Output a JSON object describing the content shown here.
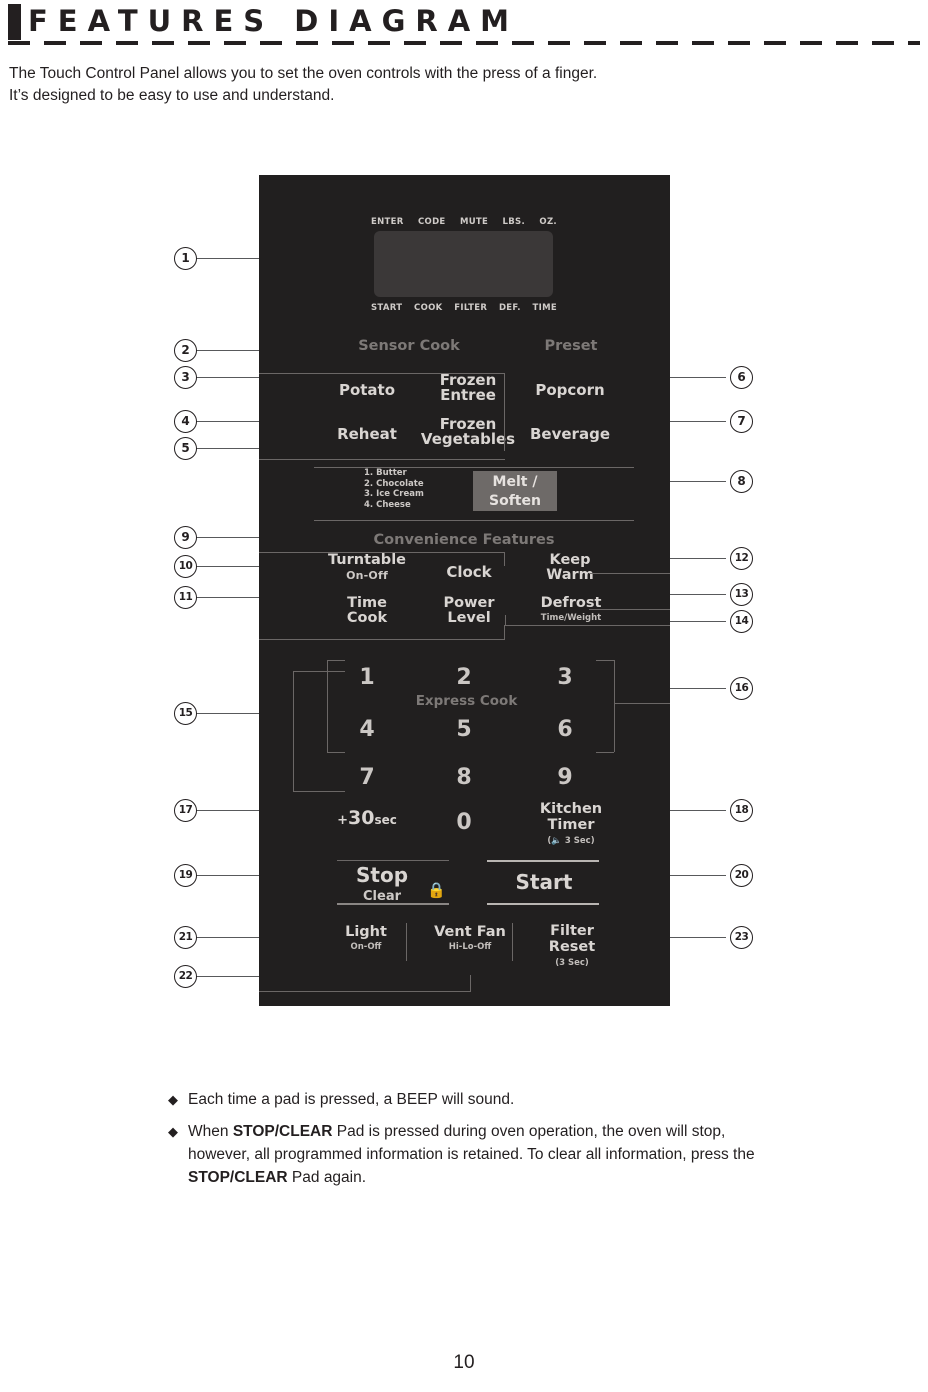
{
  "header": {
    "title": "FEATURES DIAGRAM"
  },
  "intro": {
    "line1": "The Touch Control Panel allows you to set the oven controls with the press of a finger.",
    "line2": "It’s designed to be easy to use and understand."
  },
  "panel": {
    "display": {
      "top_indicators": [
        "ENTER",
        "CODE",
        "MUTE",
        "LBS.",
        "OZ."
      ],
      "bottom_indicators": [
        "START",
        "COOK",
        "FILTER",
        "DEF.",
        "TIME"
      ]
    },
    "sections": {
      "sensor_cook": "Sensor Cook",
      "preset": "Preset",
      "convenience": "Convenience Features",
      "express_cook": "Express Cook"
    },
    "pads": {
      "potato": "Potato",
      "reheat": "Reheat",
      "frozen_entree": {
        "line1": "Frozen",
        "line2": "Entree"
      },
      "frozen_vegetables": {
        "line1": "Frozen",
        "line2": "Vegetables"
      },
      "popcorn": "Popcorn",
      "beverage": "Beverage",
      "melt_soften": {
        "line1": "Melt /",
        "line2": "Soften"
      },
      "melt_list": [
        "1. Butter",
        "2. Chocolate",
        "3. Ice Cream",
        "4. Cheese"
      ],
      "turntable": {
        "main": "Turntable",
        "sub": "On-Off"
      },
      "clock": "Clock",
      "keep_warm": {
        "line1": "Keep",
        "line2": "Warm"
      },
      "time_cook": {
        "line1": "Time",
        "line2": "Cook"
      },
      "power_level": {
        "line1": "Power",
        "line2": "Level"
      },
      "defrost": {
        "main": "Defrost",
        "sub": "Time/Weight"
      },
      "add30": {
        "plus": "+",
        "num": "30",
        "unit": "sec"
      },
      "kitchen_timer": {
        "line1": "Kitchen",
        "line2": "Timer",
        "sub": "(\u0001 3 Sec)",
        "sub_text": "3 Sec"
      },
      "stop": {
        "main": "Stop",
        "sub": "Clear"
      },
      "start": "Start",
      "light": {
        "main": "Light",
        "sub": "On-Off"
      },
      "vent_fan": {
        "main": "Vent Fan",
        "sub": "Hi-Lo-Off"
      },
      "filter_reset": {
        "line1": "Filter",
        "line2": "Reset",
        "sub": "(3 Sec)"
      },
      "numbers": [
        "1",
        "2",
        "3",
        "4",
        "5",
        "6",
        "7",
        "8",
        "9",
        "0"
      ]
    }
  },
  "callouts": {
    "left": [
      "1",
      "2",
      "3",
      "4",
      "5",
      "9",
      "10",
      "11",
      "15",
      "17",
      "19",
      "21",
      "22"
    ],
    "right": [
      "6",
      "7",
      "8",
      "12",
      "13",
      "14",
      "16",
      "18",
      "20",
      "23"
    ]
  },
  "notes": [
    {
      "text_before": "Each time a pad is pressed, a BEEP will sound."
    },
    {
      "text_before": "When ",
      "bold1": "STOP/CLEAR",
      "text_mid": " Pad is pressed during oven operation, the oven will stop, however, all programmed information is retained. To clear all information, press the ",
      "bold2": "STOP/CLEAR",
      "text_after": " Pad again."
    }
  ],
  "page_number": "10"
}
